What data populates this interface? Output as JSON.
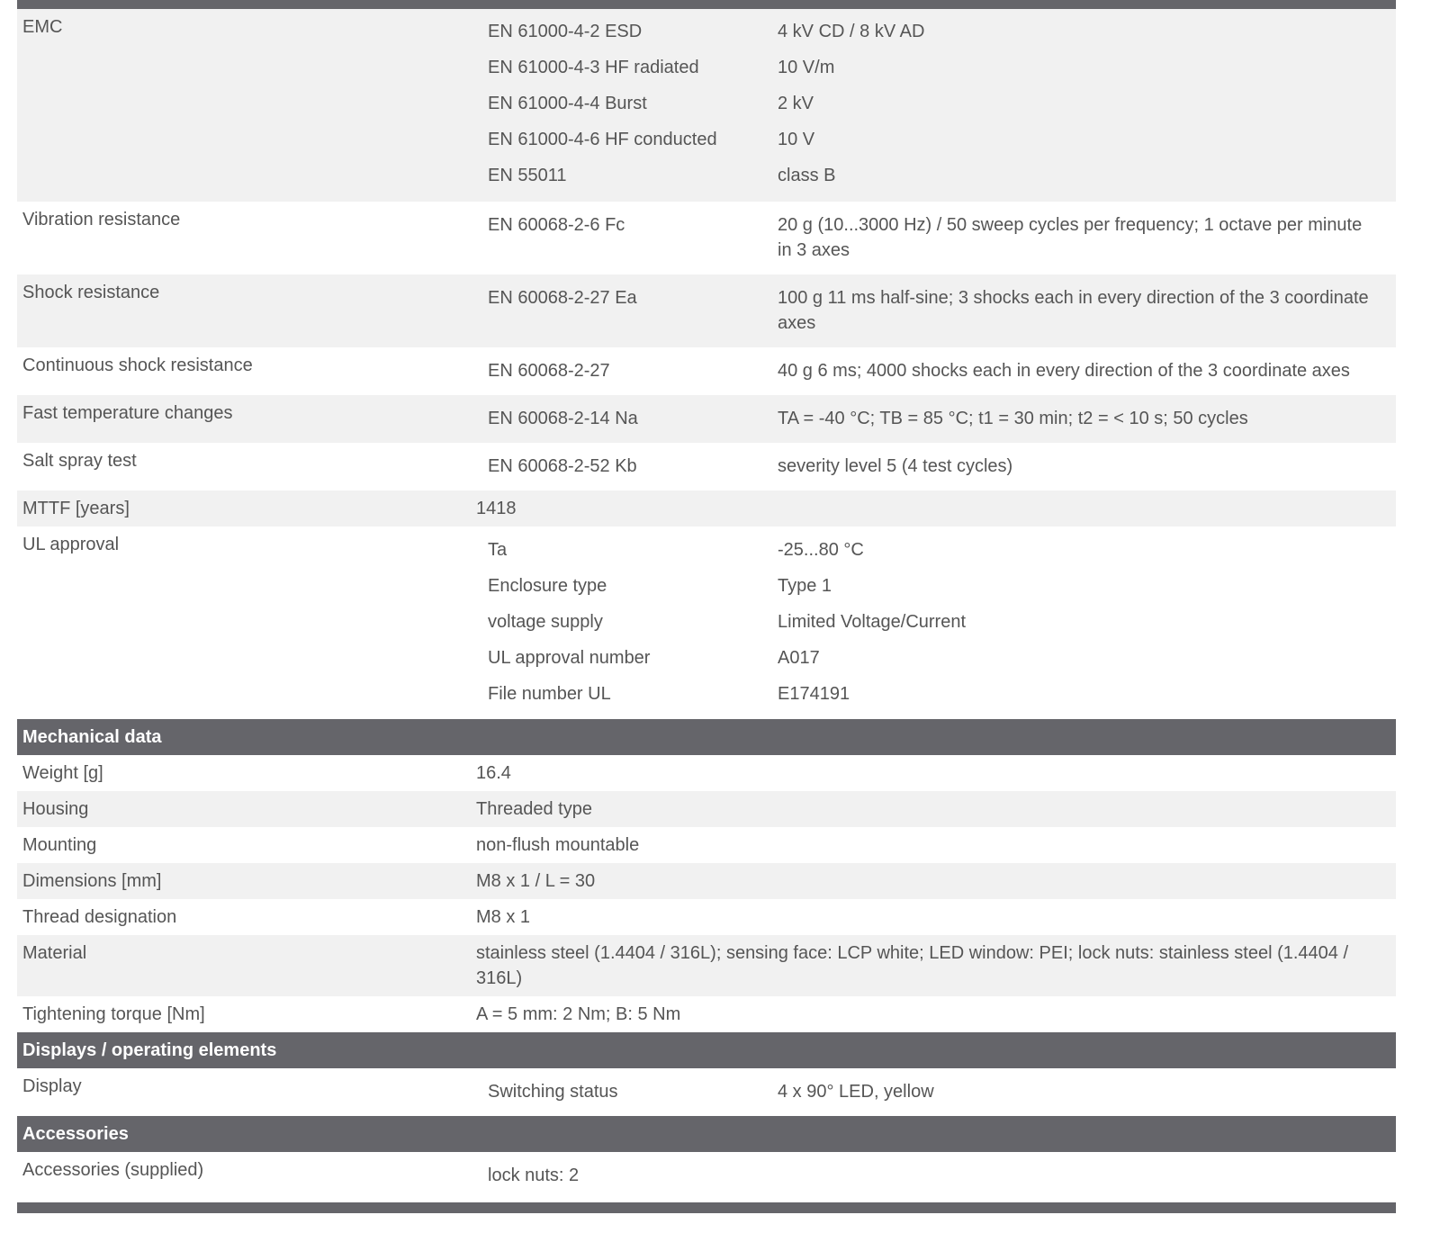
{
  "emc": {
    "label": "EMC",
    "items": [
      {
        "standard": "EN 61000-4-2 ESD",
        "value": "4 kV CD / 8 kV AD"
      },
      {
        "standard": "EN 61000-4-3 HF radiated",
        "value": "10 V/m"
      },
      {
        "standard": "EN 61000-4-4 Burst",
        "value": "2 kV"
      },
      {
        "standard": "EN 61000-4-6 HF conducted",
        "value": "10 V"
      },
      {
        "standard": "EN 55011",
        "value": "class B"
      }
    ]
  },
  "vibration": {
    "label": "Vibration resistance",
    "standard": "EN 60068-2-6 Fc",
    "value": "20 g (10...3000 Hz) / 50 sweep cycles per frequency; 1 octave per minute in 3 axes"
  },
  "shock": {
    "label": "Shock resistance",
    "standard": "EN 60068-2-27 Ea",
    "value": "100 g 11 ms half-sine; 3 shocks each in every direction of the 3 coordinate axes"
  },
  "continuous_shock": {
    "label": "Continuous shock resistance",
    "standard": "EN 60068-2-27",
    "value": "40 g 6 ms; 4000 shocks each in every direction of the 3 coordinate axes"
  },
  "fast_temp": {
    "label": "Fast temperature changes",
    "standard": "EN 60068-2-14 Na",
    "value": "TA = -40 °C; TB = 85 °C; t1 = 30 min; t2 = < 10 s; 50 cycles"
  },
  "salt_spray": {
    "label": "Salt spray test",
    "standard": "EN 60068-2-52 Kb",
    "value": "severity level 5 (4 test cycles)"
  },
  "mttf": {
    "label": "MTTF [years]",
    "value": "1418"
  },
  "ul": {
    "label": "UL approval",
    "items": [
      {
        "name": "Ta",
        "value": "-25...80 °C"
      },
      {
        "name": "Enclosure type",
        "value": "Type 1"
      },
      {
        "name": "voltage supply",
        "value": "Limited Voltage/Current"
      },
      {
        "name": "UL approval number",
        "value": "A017"
      },
      {
        "name": "File number UL",
        "value": "E174191"
      }
    ]
  },
  "mechanical": {
    "title": "Mechanical data",
    "rows": [
      {
        "label": "Weight [g]",
        "value": "16.4"
      },
      {
        "label": "Housing",
        "value": "Threaded type"
      },
      {
        "label": "Mounting",
        "value": "non-flush mountable"
      },
      {
        "label": "Dimensions [mm]",
        "value": "M8 x 1 / L = 30"
      },
      {
        "label": "Thread designation",
        "value": "M8 x 1"
      },
      {
        "label": "Material",
        "value": "stainless steel (1.4404 / 316L); sensing face: LCP white; LED window: PEI; lock nuts: stainless steel (1.4404 / 316L)"
      },
      {
        "label": "Tightening torque [Nm]",
        "value": "A = 5 mm: 2 Nm; B: 5 Nm"
      }
    ]
  },
  "displays": {
    "title": "Displays / operating elements",
    "label": "Display",
    "name": "Switching status",
    "value": "4 x 90° LED, yellow"
  },
  "accessories": {
    "title": "Accessories",
    "label": "Accessories (supplied)",
    "value": "lock nuts: 2"
  }
}
